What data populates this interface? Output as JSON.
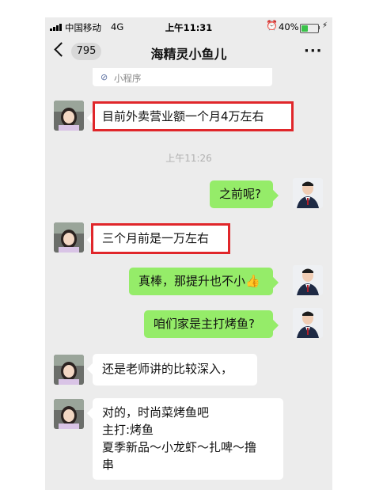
{
  "status_bar": {
    "carrier": "中国移动",
    "network": "4G",
    "time": "上午11:31",
    "battery": "40%",
    "battery_level": 0.4
  },
  "header": {
    "back_count": "795",
    "title": "海精灵小鱼儿",
    "more": "···"
  },
  "mini_program": {
    "label": "小程序",
    "icon": "link-icon"
  },
  "messages": [
    {
      "from": "other",
      "text": "目前外卖营业额一个月4万左右",
      "highlighted": true
    },
    {
      "type": "timestamp",
      "text": "上午11:26"
    },
    {
      "from": "me",
      "text": "之前呢?"
    },
    {
      "from": "other",
      "text": "三个月前是一万左右",
      "highlighted": true
    },
    {
      "from": "me",
      "text": "真棒，那提升也不小👍"
    },
    {
      "from": "me",
      "text": "咱们家是主打烤鱼?"
    },
    {
      "from": "other",
      "text": "还是老师讲的比较深入，"
    },
    {
      "from": "other",
      "text": "对的，时尚菜烤鱼吧\n主打:烤鱼\n夏季新品～小龙虾～扎啤～撸\n串"
    }
  ],
  "colors": {
    "chat_background": "#ececec",
    "bubble_me": "#95ec69",
    "bubble_other": "#ffffff",
    "highlight": "#e0262a"
  }
}
